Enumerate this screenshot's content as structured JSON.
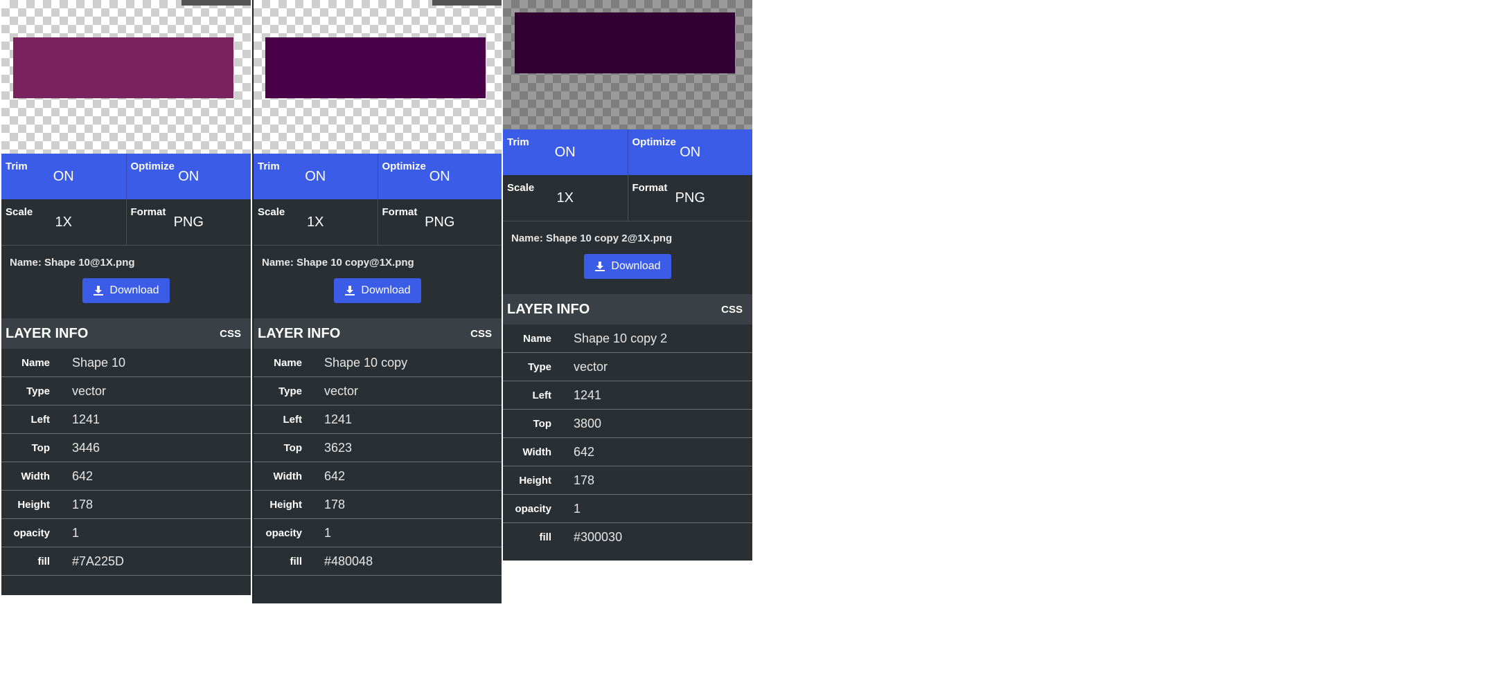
{
  "panels": [
    {
      "shape_color": "#7A225D",
      "trim_label": "Trim",
      "trim_value": "ON",
      "optimize_label": "Optimize",
      "optimize_value": "ON",
      "scale_label": "Scale",
      "scale_value": "1X",
      "format_label": "Format",
      "format_value": "PNG",
      "file_name": "Name: Shape 10@1X.png",
      "download_label": "Download",
      "layer_title": "LAYER INFO",
      "css_label": "CSS",
      "info": [
        {
          "key": "Name",
          "value": "Shape 10"
        },
        {
          "key": "Type",
          "value": "vector"
        },
        {
          "key": "Left",
          "value": "1241"
        },
        {
          "key": "Top",
          "value": "3446"
        },
        {
          "key": "Width",
          "value": "642"
        },
        {
          "key": "Height",
          "value": "178"
        },
        {
          "key": "opacity",
          "value": "1"
        },
        {
          "key": "fill",
          "value": "#7A225D"
        }
      ]
    },
    {
      "shape_color": "#480048",
      "trim_label": "Trim",
      "trim_value": "ON",
      "optimize_label": "Optimize",
      "optimize_value": "ON",
      "scale_label": "Scale",
      "scale_value": "1X",
      "format_label": "Format",
      "format_value": "PNG",
      "file_name": "Name: Shape 10 copy@1X.png",
      "download_label": "Download",
      "layer_title": "LAYER INFO",
      "css_label": "CSS",
      "info": [
        {
          "key": "Name",
          "value": "Shape 10 copy"
        },
        {
          "key": "Type",
          "value": "vector"
        },
        {
          "key": "Left",
          "value": "1241"
        },
        {
          "key": "Top",
          "value": "3623"
        },
        {
          "key": "Width",
          "value": "642"
        },
        {
          "key": "Height",
          "value": "178"
        },
        {
          "key": "opacity",
          "value": "1"
        },
        {
          "key": "fill",
          "value": "#480048"
        }
      ]
    },
    {
      "shape_color": "#300030",
      "trim_label": "Trim",
      "trim_value": "ON",
      "optimize_label": "Optimize",
      "optimize_value": "ON",
      "scale_label": "Scale",
      "scale_value": "1X",
      "format_label": "Format",
      "format_value": "PNG",
      "file_name": "Name: Shape 10 copy 2@1X.png",
      "download_label": "Download",
      "layer_title": "LAYER INFO",
      "css_label": "CSS",
      "info": [
        {
          "key": "Name",
          "value": "Shape 10 copy 2"
        },
        {
          "key": "Type",
          "value": "vector"
        },
        {
          "key": "Left",
          "value": "1241"
        },
        {
          "key": "Top",
          "value": "3800"
        },
        {
          "key": "Width",
          "value": "642"
        },
        {
          "key": "Height",
          "value": "178"
        },
        {
          "key": "opacity",
          "value": "1"
        },
        {
          "key": "fill",
          "value": "#300030"
        }
      ]
    }
  ]
}
